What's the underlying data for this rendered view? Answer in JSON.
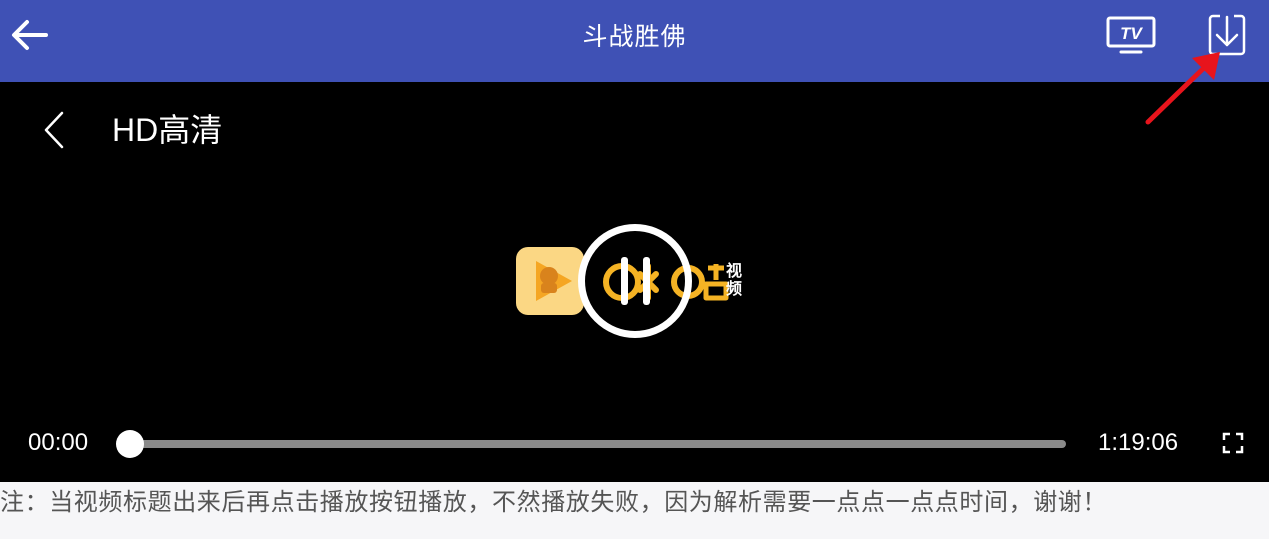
{
  "appbar": {
    "title": "斗战胜佛",
    "back_icon": "arrow-left-icon",
    "tv_label": "TV",
    "download_icon": "download-icon",
    "background": "#3f51b5"
  },
  "player": {
    "quality_label": "HD高清",
    "back_icon": "chevron-left-icon",
    "logo_tag": "视频",
    "state_icon": "pause-icon",
    "current_time": "00:00",
    "duration": "1:19:06",
    "progress_fraction": 0,
    "fullscreen_icon": "fullscreen-icon",
    "logo_color": "#f5b324"
  },
  "annotation": {
    "color": "#e8141c",
    "icon": "red-arrow-icon"
  },
  "notice": {
    "text": "注：当视频标题出来后再点击播放按钮播放，不然播放失败，因为解析需要一点点一点点时间，谢谢！"
  }
}
